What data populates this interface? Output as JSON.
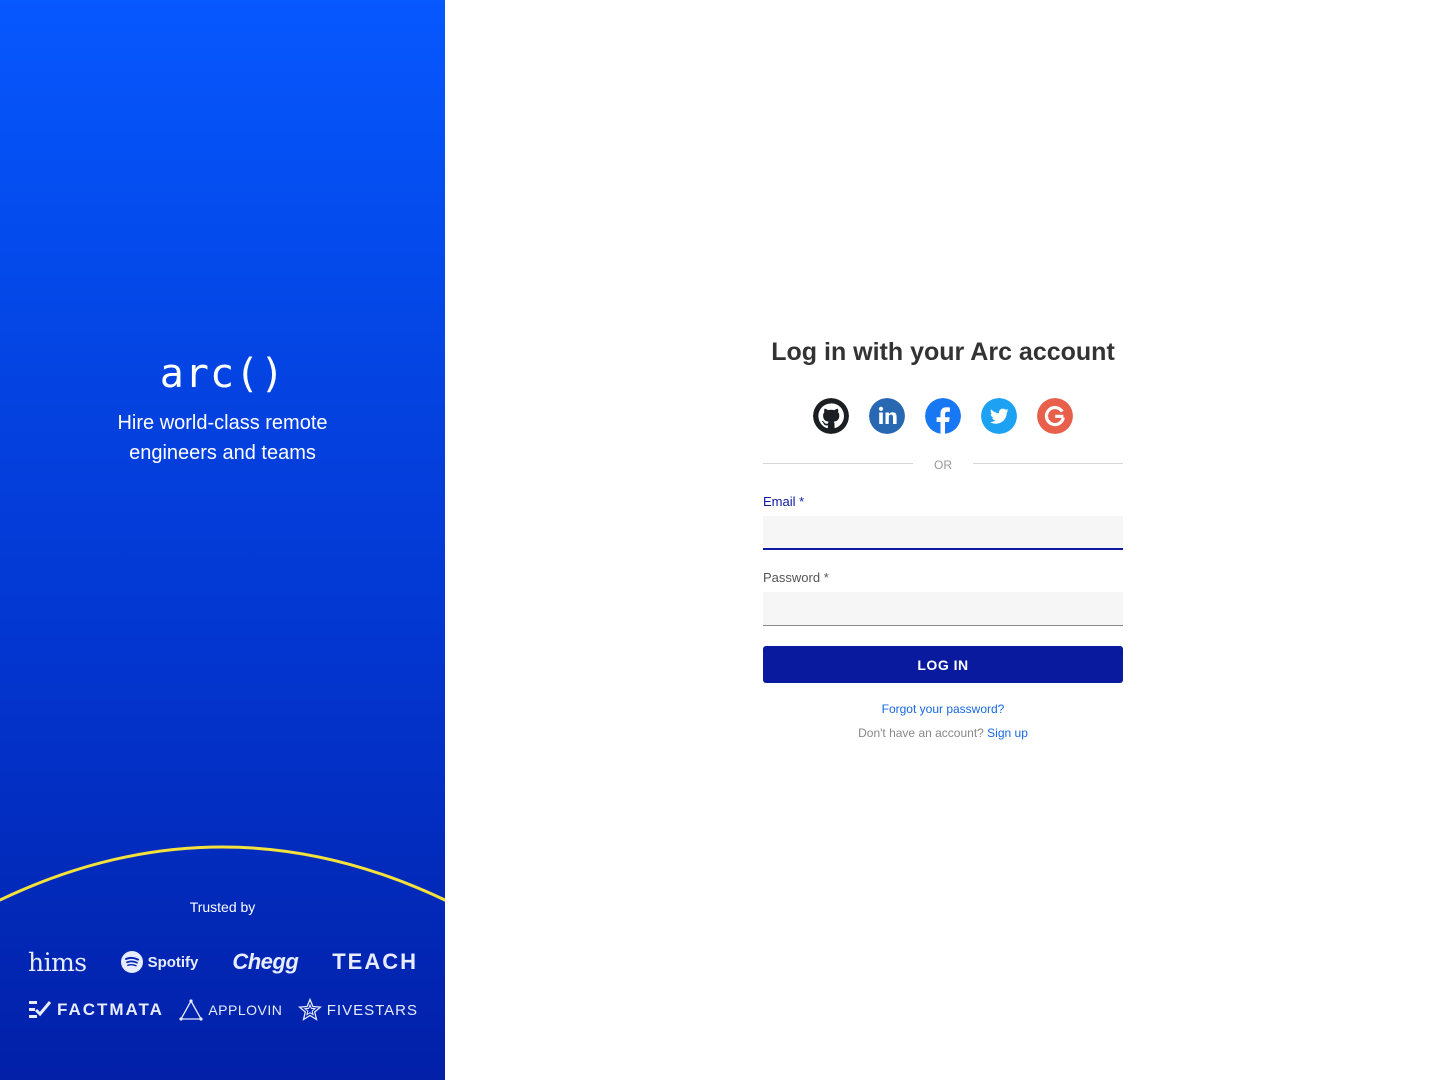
{
  "brand": {
    "logo": "arc()",
    "tagline": "Hire world-class remote engineers and teams",
    "trusted_label": "Trusted by",
    "clients_row1": [
      "hims",
      "Spotify",
      "Chegg",
      "TEACH"
    ],
    "clients_row2": [
      "FACTMATA",
      "APPLOVIN",
      "FIVESTARS"
    ]
  },
  "form": {
    "title": "Log in with your Arc account",
    "social": [
      "github-icon",
      "linkedin-icon",
      "facebook-icon",
      "twitter-icon",
      "google-icon"
    ],
    "divider": "OR",
    "email_label": "Email *",
    "email_value": "",
    "password_label": "Password *",
    "password_value": "",
    "login_button": "LOG IN",
    "forgot_link": "Forgot your password?",
    "no_account": "Don't have an account?",
    "signup_link": "Sign up"
  },
  "colors": {
    "panel_top": "#0658ff",
    "panel_bottom": "#0220a8",
    "arc_line": "#f4e13c",
    "primary": "#0a1a9e",
    "link": "#1668e3"
  }
}
